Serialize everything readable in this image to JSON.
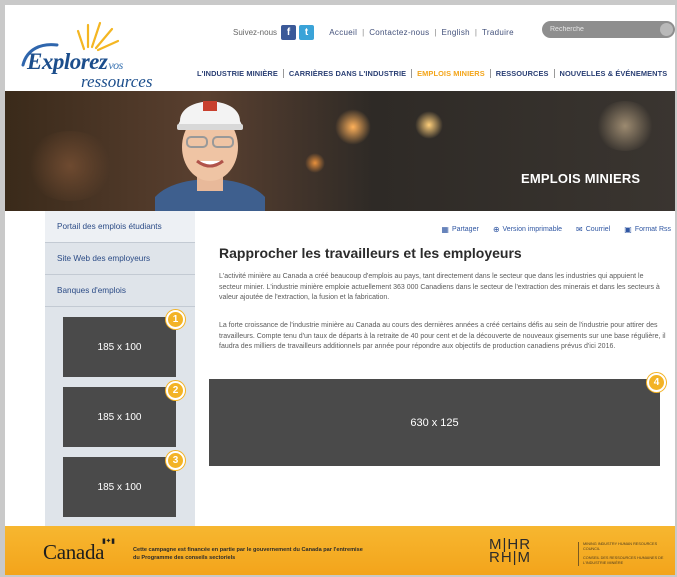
{
  "header": {
    "logo": {
      "word1": "Explorez",
      "word1_suffix": "vos",
      "word2": "ressources"
    },
    "follow_label": "Suivez-nous",
    "social": {
      "facebook_glyph": "f",
      "twitter_glyph": "t"
    },
    "top_links": [
      "Accueil",
      "Contactez-nous",
      "English",
      "Traduire"
    ],
    "search": {
      "placeholder": "Recherche",
      "value": ""
    },
    "nav": [
      {
        "label": "L'INDUSTRIE MINIÈRE",
        "active": false
      },
      {
        "label": "CARRIÈRES DANS L'INDUSTRIE",
        "active": false
      },
      {
        "label": "EMPLOIS MINIERS",
        "active": true
      },
      {
        "label": "RESSOURCES",
        "active": false
      },
      {
        "label": "NOUVELLES & ÉVÉNEMENTS",
        "active": false
      }
    ]
  },
  "hero": {
    "title": "EMPLOIS MINIERS"
  },
  "sidebar": {
    "items": [
      {
        "label": "Portail des emplois étudiants"
      },
      {
        "label": "Site Web des employeurs"
      },
      {
        "label": "Banques d'emplois"
      }
    ],
    "ads": [
      {
        "size": "185 x 100",
        "badge": "1"
      },
      {
        "size": "185 x 100",
        "badge": "2"
      },
      {
        "size": "185 x 100",
        "badge": "3"
      }
    ]
  },
  "content": {
    "tools": {
      "share": "Partager",
      "print": "Version imprimable",
      "email": "Courriel",
      "rss": "Format Rss"
    },
    "headline": "Rapprocher les travailleurs et les employeurs",
    "paragraphs": [
      "L'activité minière au Canada a créé beaucoup d'emplois au pays, tant directement dans le secteur que dans les industries qui appuient le secteur minier. L'industrie minière emploie actuellement 363 000 Canadiens dans le secteur de l'extraction des minerais et dans les secteurs à valeur ajoutée de l'extraction, la fusion et la fabrication.",
      "La forte croissance de l'industrie minière au Canada au cours des dernières années a créé certains défis au sein de l'industrie pour attirer des travailleurs. Compte tenu d'un taux de départs à la retraite de 40 pour cent et de la découverte de nouveaux gisements sur une base régulière, il faudra des milliers de travailleurs additionnels par année pour répondre aux objectifs de production canadiens prévus d'ici 2016."
    ],
    "big_ad": {
      "size": "630 x 125",
      "badge": "4"
    }
  },
  "footer": {
    "canada_wordmark": "Canada",
    "funding_text": "Cette campagne est financée en partie par le gouvernement du Canada par l'entremise du Programme des conseils sectoriels",
    "mihr_logo_top": "M|HR",
    "mihr_logo_bottom": "RH|M",
    "council_en": "Mining Industry Human Resources Council",
    "council_fr": "Conseil des ressources humaines de l'industrie minière"
  },
  "colors": {
    "accent": "#f3a51a",
    "nav_text": "#2a3f74",
    "link": "#2f56a2",
    "footer": "#f5ad22",
    "ad_box": "#4a4a4a",
    "badge": "#f3b325"
  }
}
